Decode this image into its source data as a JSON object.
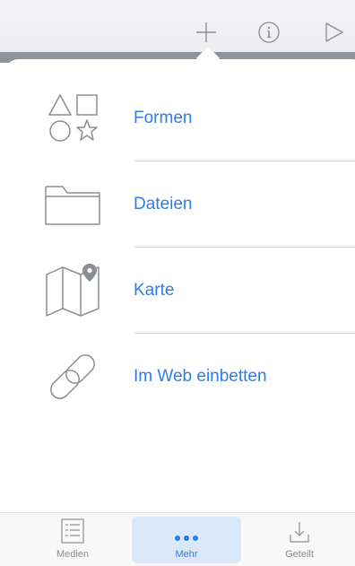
{
  "toolbar": {
    "buttons": [
      {
        "icon": "plus-icon"
      },
      {
        "icon": "info-icon"
      },
      {
        "icon": "play-icon"
      }
    ]
  },
  "menu": {
    "items": [
      {
        "label": "Formen",
        "icon": "shapes-icon"
      },
      {
        "label": "Dateien",
        "icon": "folder-icon"
      },
      {
        "label": "Karte",
        "icon": "map-icon"
      },
      {
        "label": "Im Web einbetten",
        "icon": "link-icon"
      }
    ]
  },
  "tabbar": {
    "tabs": [
      {
        "label": "Medien",
        "icon": "list-icon",
        "selected": false
      },
      {
        "label": "Mehr",
        "icon": "more-dots-icon",
        "selected": true
      },
      {
        "label": "Geteilt",
        "icon": "download-tray-icon",
        "selected": false
      }
    ]
  },
  "colors": {
    "accent": "#2b7de9",
    "icon_gray": "#8a8d93",
    "selected_tab_bg": "#dbe8fa"
  }
}
